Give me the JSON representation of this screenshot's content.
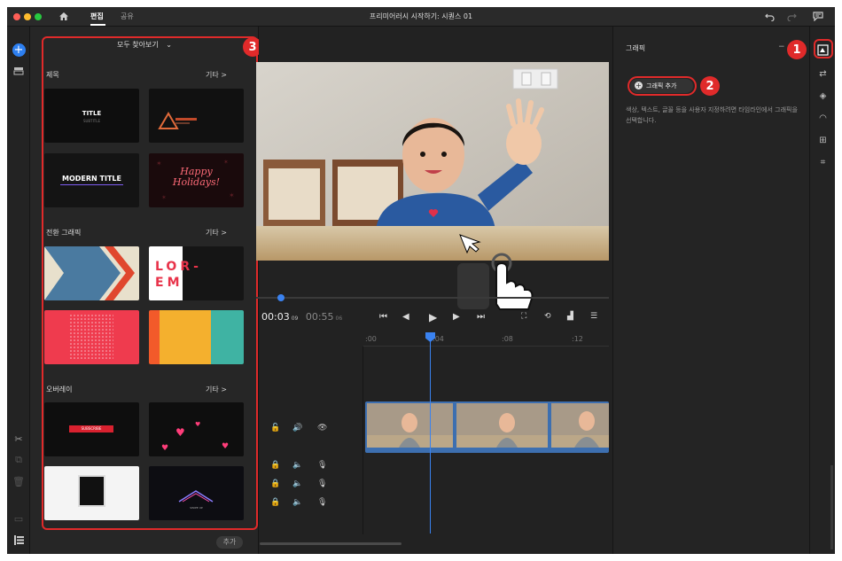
{
  "titlebar": {
    "tab_edit": "편집",
    "tab_share": "공유",
    "title": "프리미어러시 시작하기: 시퀀스 01"
  },
  "graphics_browser": {
    "browse_all": "모두 찾아보기",
    "add_button": "추가",
    "sections": [
      {
        "title": "제목",
        "more": "기타 >",
        "thumbs": [
          {
            "name": "TITLE",
            "sub": "SUBTITLE"
          },
          {
            "name": "warning-triangle"
          },
          {
            "name": "MODERN TITLE"
          },
          {
            "name": "Happy Holidays!"
          }
        ]
      },
      {
        "title": "전환 그래픽",
        "more": "기타 >",
        "thumbs": [
          {
            "name": "chevron-arrow"
          },
          {
            "name": "LOR- EM"
          },
          {
            "name": "red-dots"
          },
          {
            "name": "color-stripes"
          }
        ]
      },
      {
        "title": "오버레이",
        "more": "기타 >",
        "thumbs": [
          {
            "name": "subscribe-bar",
            "text": "SUBSCRIBE"
          },
          {
            "name": "hearts"
          },
          {
            "name": "photo-frame"
          },
          {
            "name": "roof-outline",
            "text": "SWIPE UP"
          }
        ]
      }
    ]
  },
  "timeline": {
    "current_time": "00:03",
    "current_frames": "09",
    "total_time": "00:55",
    "total_frames": "06",
    "ruler": [
      ":00",
      ":04",
      ":08",
      ":12"
    ],
    "playhead_fraction": 0.27
  },
  "graphics_panel": {
    "title": "그래픽",
    "add_graphic": "그래픽 추가",
    "help_text": "색상, 텍스트, 글꼴 등을 사용자 지정하려면 타임라인에서 그래픽을 선택합니다."
  },
  "callouts": [
    "1",
    "2",
    "3"
  ],
  "colors": {
    "accent": "#2d7ff0",
    "callout": "#e02a2a"
  }
}
